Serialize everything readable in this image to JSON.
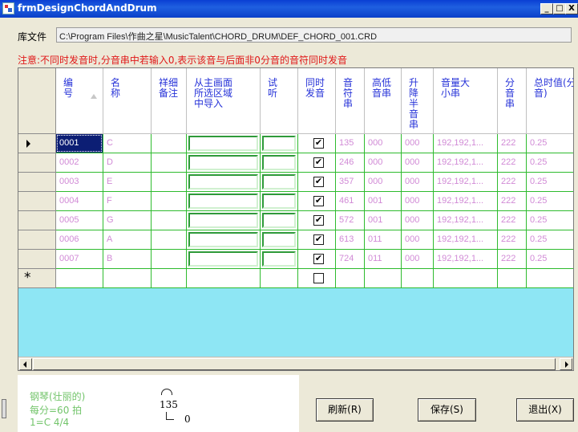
{
  "window": {
    "title": "frmDesignChordAndDrum",
    "min": "_",
    "max": "□",
    "close": "X"
  },
  "library": {
    "label": "库文件",
    "path": "C:\\Program Files\\作曲之星\\MusicTalent\\CHORD_DRUM\\DEF_CHORD_001.CRD"
  },
  "notice": "注意:不同时发音时,分音串中若输入0,表示该音与后面非0分音的音符同时发音",
  "grid": {
    "columns": [
      {
        "label": "编\n号",
        "sort": "ascending"
      },
      {
        "label": "名\n称"
      },
      {
        "label": "祥细\n备注"
      },
      {
        "label": "从主画面\n所选区域\n中导入"
      },
      {
        "label": "试\n听"
      },
      {
        "label": "同时\n发音"
      },
      {
        "label": "音\n符\n串"
      },
      {
        "label": "高低\n音串"
      },
      {
        "label": "升\n降\n半\n音\n串"
      },
      {
        "label": "音量大\n小串"
      },
      {
        "label": "分\n音\n串"
      },
      {
        "label": "总时值(分\n音)"
      }
    ],
    "rows": [
      {
        "id": "0001",
        "name": "C",
        "simultaneous": true,
        "notes": "135",
        "octave": "000",
        "accidental": "000",
        "volume": "192,192,1...",
        "split": "222",
        "duration": "0.25"
      },
      {
        "id": "0002",
        "name": "D",
        "simultaneous": true,
        "notes": "246",
        "octave": "000",
        "accidental": "000",
        "volume": "192,192,1...",
        "split": "222",
        "duration": "0.25"
      },
      {
        "id": "0003",
        "name": "E",
        "simultaneous": true,
        "notes": "357",
        "octave": "000",
        "accidental": "000",
        "volume": "192,192,1...",
        "split": "222",
        "duration": "0.25"
      },
      {
        "id": "0004",
        "name": "F",
        "simultaneous": true,
        "notes": "461",
        "octave": "001",
        "accidental": "000",
        "volume": "192,192,1...",
        "split": "222",
        "duration": "0.25"
      },
      {
        "id": "0005",
        "name": "G",
        "simultaneous": true,
        "notes": "572",
        "octave": "001",
        "accidental": "000",
        "volume": "192,192,1...",
        "split": "222",
        "duration": "0.25"
      },
      {
        "id": "0006",
        "name": "A",
        "simultaneous": true,
        "notes": "613",
        "octave": "011",
        "accidental": "000",
        "volume": "192,192,1...",
        "split": "222",
        "duration": "0.25"
      },
      {
        "id": "0007",
        "name": "B",
        "simultaneous": true,
        "notes": "724",
        "octave": "011",
        "accidental": "000",
        "volume": "192,192,1...",
        "split": "222",
        "duration": "0.25"
      }
    ],
    "new_row_marker": "*",
    "current_row_marker": "▶"
  },
  "info": {
    "instrument": "钢琴(壮丽的)",
    "tempo": "每分=60 拍",
    "key": "1=C  4/4",
    "note_number": "135",
    "note_sub": "0"
  },
  "buttons": {
    "refresh": "刷新(R)",
    "save": "保存(S)",
    "exit": "退出(X)"
  },
  "colors": {
    "grid_line": "#2ebb2e",
    "cell_text": "#d18ad6",
    "header_text": "#2632d8",
    "notice": "#e01818",
    "grid_background": "#8ee6f4",
    "selected": "#0c1e74"
  }
}
